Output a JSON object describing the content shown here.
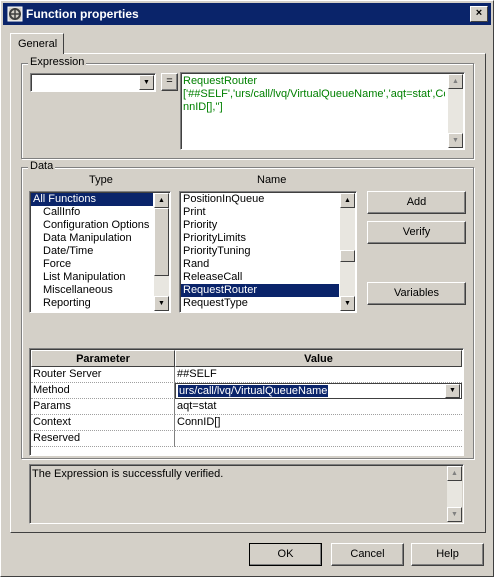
{
  "window": {
    "title": "Function properties",
    "close": "×"
  },
  "tabs": [
    {
      "label": "General"
    }
  ],
  "expression": {
    "group_label": "Expression",
    "combo_value": "",
    "equals": "=",
    "text_line1": "RequestRouter",
    "text_line2": "['##SELF','urs/call/lvq/VirtualQueueName','aqt=stat',Co",
    "text_line3": "nnID[],'']"
  },
  "data": {
    "group_label": "Data",
    "type_header": "Type",
    "name_header": "Name",
    "type_items": [
      {
        "label": "All Functions",
        "selected": true
      },
      {
        "label": "CallInfo"
      },
      {
        "label": "Configuration Options"
      },
      {
        "label": "Data Manipulation"
      },
      {
        "label": "Date/Time"
      },
      {
        "label": "Force"
      },
      {
        "label": "List Manipulation"
      },
      {
        "label": "Miscellaneous"
      },
      {
        "label": "Reporting"
      }
    ],
    "name_items": [
      {
        "label": "PositionInQueue"
      },
      {
        "label": "Print"
      },
      {
        "label": "Priority"
      },
      {
        "label": "PriorityLimits"
      },
      {
        "label": "PriorityTuning"
      },
      {
        "label": "Rand"
      },
      {
        "label": "ReleaseCall"
      },
      {
        "label": "RequestRouter",
        "selected": true
      },
      {
        "label": "RequestType"
      }
    ],
    "buttons": {
      "add": "Add",
      "verify": "Verify",
      "variables": "Variables"
    }
  },
  "params": {
    "headers": {
      "parameter": "Parameter",
      "value": "Value"
    },
    "rows": [
      {
        "param": "Router Server",
        "value": "##SELF"
      },
      {
        "param": "Method",
        "value": "urs/call/lvq/VirtualQueueName"
      },
      {
        "param": "Params",
        "value": "aqt=stat"
      },
      {
        "param": "Context",
        "value": "ConnID[]"
      },
      {
        "param": "Reserved",
        "value": ""
      }
    ]
  },
  "status": {
    "message": "The Expression is successfully verified."
  },
  "footer": {
    "ok": "OK",
    "cancel": "Cancel",
    "help": "Help"
  }
}
